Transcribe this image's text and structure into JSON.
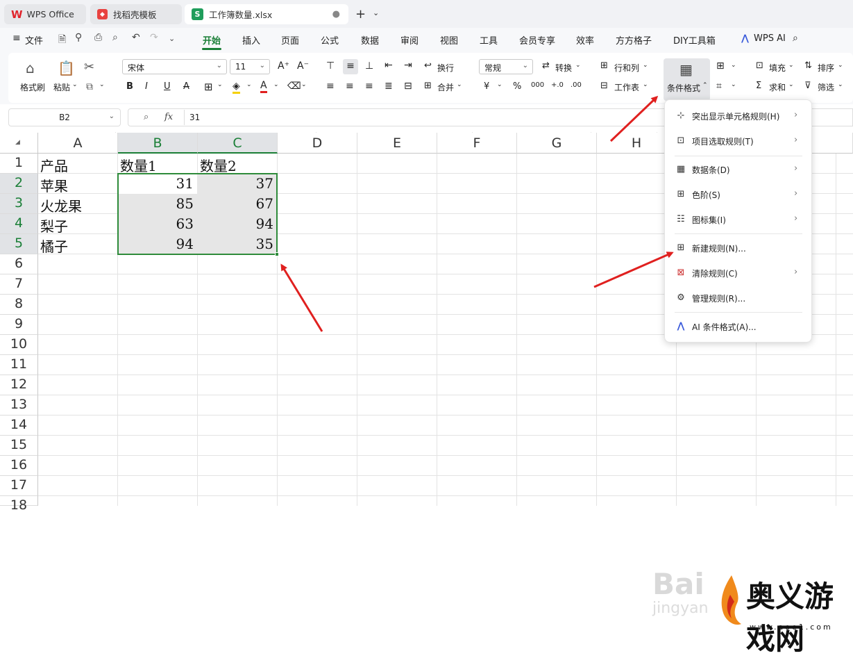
{
  "tabs": [
    {
      "label": "WPS Office"
    },
    {
      "label": "找稻壳模板"
    },
    {
      "label": "工作簿数量.xlsx"
    }
  ],
  "menubar": {
    "file": "文件",
    "items": [
      "开始",
      "插入",
      "页面",
      "公式",
      "数据",
      "审阅",
      "视图",
      "工具",
      "会员专享",
      "效率",
      "方方格子",
      "DIY工具箱",
      "WPS AI"
    ]
  },
  "ribbon": {
    "format_painter": "格式刷",
    "paste": "粘贴",
    "font_name": "宋体",
    "font_size": "11",
    "wrap": "换行",
    "merge": "合并",
    "number_format": "常规",
    "convert": "转换",
    "row_col": "行和列",
    "worksheet": "工作表",
    "cond_format": "条件格式",
    "fill": "填充",
    "sort": "排序",
    "sum": "求和",
    "filter": "筛选"
  },
  "formula_bar": {
    "name_box": "B2",
    "fx": "fx",
    "value": "31"
  },
  "sheet": {
    "columns": [
      "A",
      "B",
      "C",
      "D",
      "E",
      "F",
      "G",
      "H"
    ],
    "rows": [
      "1",
      "2",
      "3",
      "4",
      "5",
      "6",
      "7",
      "8",
      "9",
      "10",
      "11",
      "12",
      "13",
      "14",
      "15",
      "16",
      "17",
      "18"
    ],
    "headers": [
      "产品",
      "数量1",
      "数量2"
    ],
    "data": [
      {
        "product": "苹果",
        "q1": "31",
        "q2": "37"
      },
      {
        "product": "火龙果",
        "q1": "85",
        "q2": "67"
      },
      {
        "product": "梨子",
        "q1": "63",
        "q2": "94"
      },
      {
        "product": "橘子",
        "q1": "94",
        "q2": "35"
      }
    ]
  },
  "dropdown_menu": {
    "items": [
      {
        "label": "突出显示单元格规则(H)",
        "icon": "highlight-rules-icon",
        "submenu": true
      },
      {
        "label": "项目选取规则(T)",
        "icon": "top-bottom-rules-icon",
        "submenu": true
      },
      {
        "label": "数据条(D)",
        "icon": "data-bars-icon",
        "submenu": true
      },
      {
        "label": "色阶(S)",
        "icon": "color-scales-icon",
        "submenu": true
      },
      {
        "label": "图标集(I)",
        "icon": "icon-sets-icon",
        "submenu": true
      },
      {
        "label": "新建规则(N)...",
        "icon": "new-rule-icon",
        "submenu": false
      },
      {
        "label": "清除规则(C)",
        "icon": "clear-rules-icon",
        "submenu": true
      },
      {
        "label": "管理规则(R)...",
        "icon": "manage-rules-icon",
        "submenu": false
      },
      {
        "label": "AI 条件格式(A)...",
        "icon": "ai-icon",
        "submenu": false
      }
    ]
  },
  "watermark": {
    "baidu": "Bai",
    "jingyan": "jingyan",
    "site_name": "奥义游戏网",
    "site_url": "www.aoe1.com"
  },
  "colors": {
    "accent_green": "#1a7f37",
    "selection_border": "#2e8b3a",
    "arrow_red": "#e0201f"
  }
}
